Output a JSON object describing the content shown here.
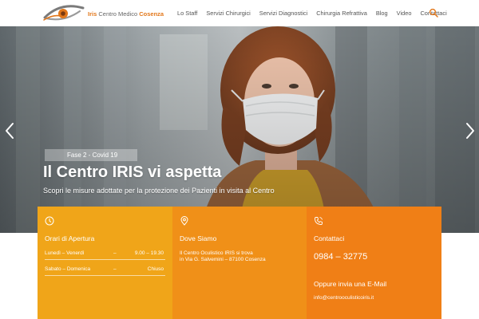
{
  "header": {
    "logo": {
      "brand": "Iris",
      "middle": "Centro Medico",
      "city": "Cosenza"
    },
    "nav": [
      {
        "label": "Lo Staff"
      },
      {
        "label": "Servizi Chirurgici"
      },
      {
        "label": "Servizi Diagnostici"
      },
      {
        "label": "Chirurgia Refrattiva"
      },
      {
        "label": "Blog"
      },
      {
        "label": "Video"
      },
      {
        "label": "Contattaci"
      }
    ],
    "search_icon": "search-icon"
  },
  "hero": {
    "badge": "Fase 2 - Covid 19",
    "title": "Il Centro IRIS vi aspetta",
    "subtitle": "Scopri le misure adottate per la protezione dei Pazienti in visita al Centro",
    "prev_icon": "chevron-left-icon",
    "next_icon": "chevron-right-icon"
  },
  "boxes": {
    "hours": {
      "icon": "clock-icon",
      "title": "Orari di Apertura",
      "rows": [
        {
          "day": "Lunedì – Venerdì",
          "dash": "–",
          "time": "9.00 – 19.30"
        },
        {
          "day": "Sabato – Domenica",
          "dash": "–",
          "time": "Chiuso"
        }
      ]
    },
    "location": {
      "icon": "map-pin-icon",
      "title": "Dove Siamo",
      "line1": "Il Centro Oculistico IRIS si trova",
      "line2": "in Via G. Salvemini – 87100 Cosenza"
    },
    "contact": {
      "icon": "phone-icon",
      "title": "Contattaci",
      "phone": "0984 – 32775",
      "email_title": "Oppure invia una E-Mail",
      "email": "info@centrooculisticoiris.it"
    }
  },
  "colors": {
    "accent": "#e2771a",
    "box_hours": "#f0a519",
    "box_location": "#f09018",
    "box_contact": "#f07f16"
  }
}
